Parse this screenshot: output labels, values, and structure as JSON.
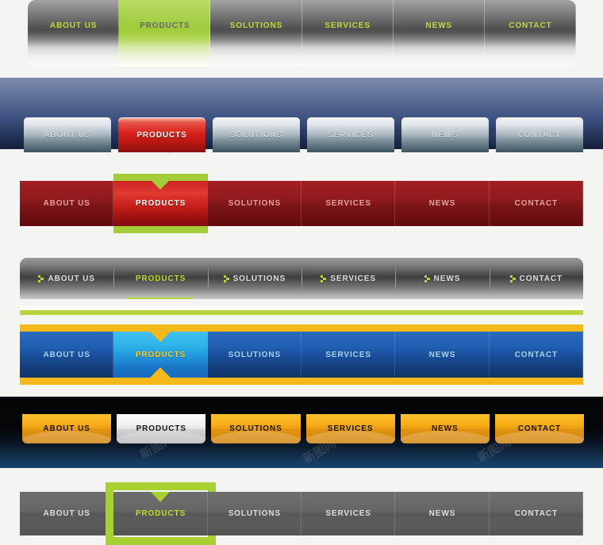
{
  "menu_items": [
    "ABOUT US",
    "PRODUCTS",
    "SOLUTIONS",
    "SERVICES",
    "NEWS",
    "CONTACT"
  ],
  "active_item": "PRODUCTS",
  "watermark": "新图网",
  "bars": [
    {
      "id": "bar1",
      "name": "grey-glossy-reflection-nav",
      "style": "grey gradient with mirror reflection, rounded corners",
      "items": [
        "ABOUT US",
        "PRODUCTS",
        "SOLUTIONS",
        "SERVICES",
        "NEWS",
        "CONTACT"
      ],
      "active_index": 1,
      "colors": {
        "label": "#bfd730",
        "active_bg": "#a0ce36",
        "active_label": "#5f6063",
        "bg_top": "#8e8e8e",
        "bg_mid": "#4a4a4a"
      }
    },
    {
      "id": "bar2",
      "name": "blue-panel-silver-buttons-nav",
      "style": "blue gradient panel with silver beveled buttons",
      "items": [
        "ABOUT US",
        "PRODUCTS",
        "SOLUTIONS",
        "SERVICES",
        "NEWS",
        "CONTACT"
      ],
      "active_index": 1,
      "colors": {
        "panel_top": "#7b8bad",
        "panel_bottom": "#16213c",
        "button_light": "#f3f5f7",
        "button_dark": "#3e5560",
        "active_bg": "#d8231d",
        "label": "#c9d4dc",
        "active_label": "#ffffff"
      }
    },
    {
      "id": "bar3",
      "name": "dark-red-green-accent-nav",
      "style": "dark red bar, active tab with green rails and downward notch",
      "items": [
        "ABOUT US",
        "PRODUCTS",
        "SOLUTIONS",
        "SERVICES",
        "NEWS",
        "CONTACT"
      ],
      "active_index": 1,
      "colors": {
        "bg": "#8e1a1d",
        "bg_bottom": "#62090c",
        "active_bg": "#e03a31",
        "accent": "#a3cc39",
        "label": "#e1a19a",
        "active_label": "#ffffff"
      }
    },
    {
      "id": "bar4",
      "name": "grey-arrow-bullet-nav",
      "style": "grey gradient bar with green arrow bullets, green underline and dropdown tab",
      "items": [
        "ABOUT US",
        "PRODUCTS",
        "SOLUTIONS",
        "SERVICES",
        "NEWS",
        "CONTACT"
      ],
      "active_index": 1,
      "bullet_icon": "green-arrow-bullet",
      "colors": {
        "bg_top": "#9a9a9a",
        "bg_mid": "#3f3f3f",
        "label": "#dcdcdc",
        "active_label": "#bcd62f",
        "accent": "#b5d63c"
      }
    },
    {
      "id": "bar5",
      "name": "blue-gold-rail-nav",
      "style": "blue bar between gold rails, active tab with yellow chevron notches",
      "items": [
        "ABOUT US",
        "PRODUCTS",
        "SOLUTIONS",
        "SERVICES",
        "NEWS",
        "CONTACT"
      ],
      "active_index": 1,
      "colors": {
        "bg": "#1f5eb0",
        "bg_bottom": "#103468",
        "active_bg": "#2fb4ea",
        "rail": "#f5b91c",
        "label": "#a9d2f2",
        "active_label": "#ffcc22"
      }
    },
    {
      "id": "bar6",
      "name": "dark-panel-orange-buttons-nav",
      "style": "near-black panel with glossy orange buttons, active button silver",
      "items": [
        "ABOUT US",
        "PRODUCTS",
        "SOLUTIONS",
        "SERVICES",
        "NEWS",
        "CONTACT"
      ],
      "active_index": 1,
      "colors": {
        "panel_top": "#040506",
        "panel_bottom": "#1b4470",
        "button": "#f7ae18",
        "active_button": "#e6e6e6",
        "label": "#141414"
      }
    },
    {
      "id": "bar7",
      "name": "grey-green-frame-nav",
      "style": "flat grey bar with thick green frame around the active tab and top notch",
      "items": [
        "ABOUT US",
        "PRODUCTS",
        "SOLUTIONS",
        "SERVICES",
        "NEWS",
        "CONTACT"
      ],
      "active_index": 1,
      "colors": {
        "bg": "#5f5f5f",
        "frame": "#a8d033",
        "label": "#dedede",
        "active_label": "#c2dc31"
      }
    }
  ]
}
